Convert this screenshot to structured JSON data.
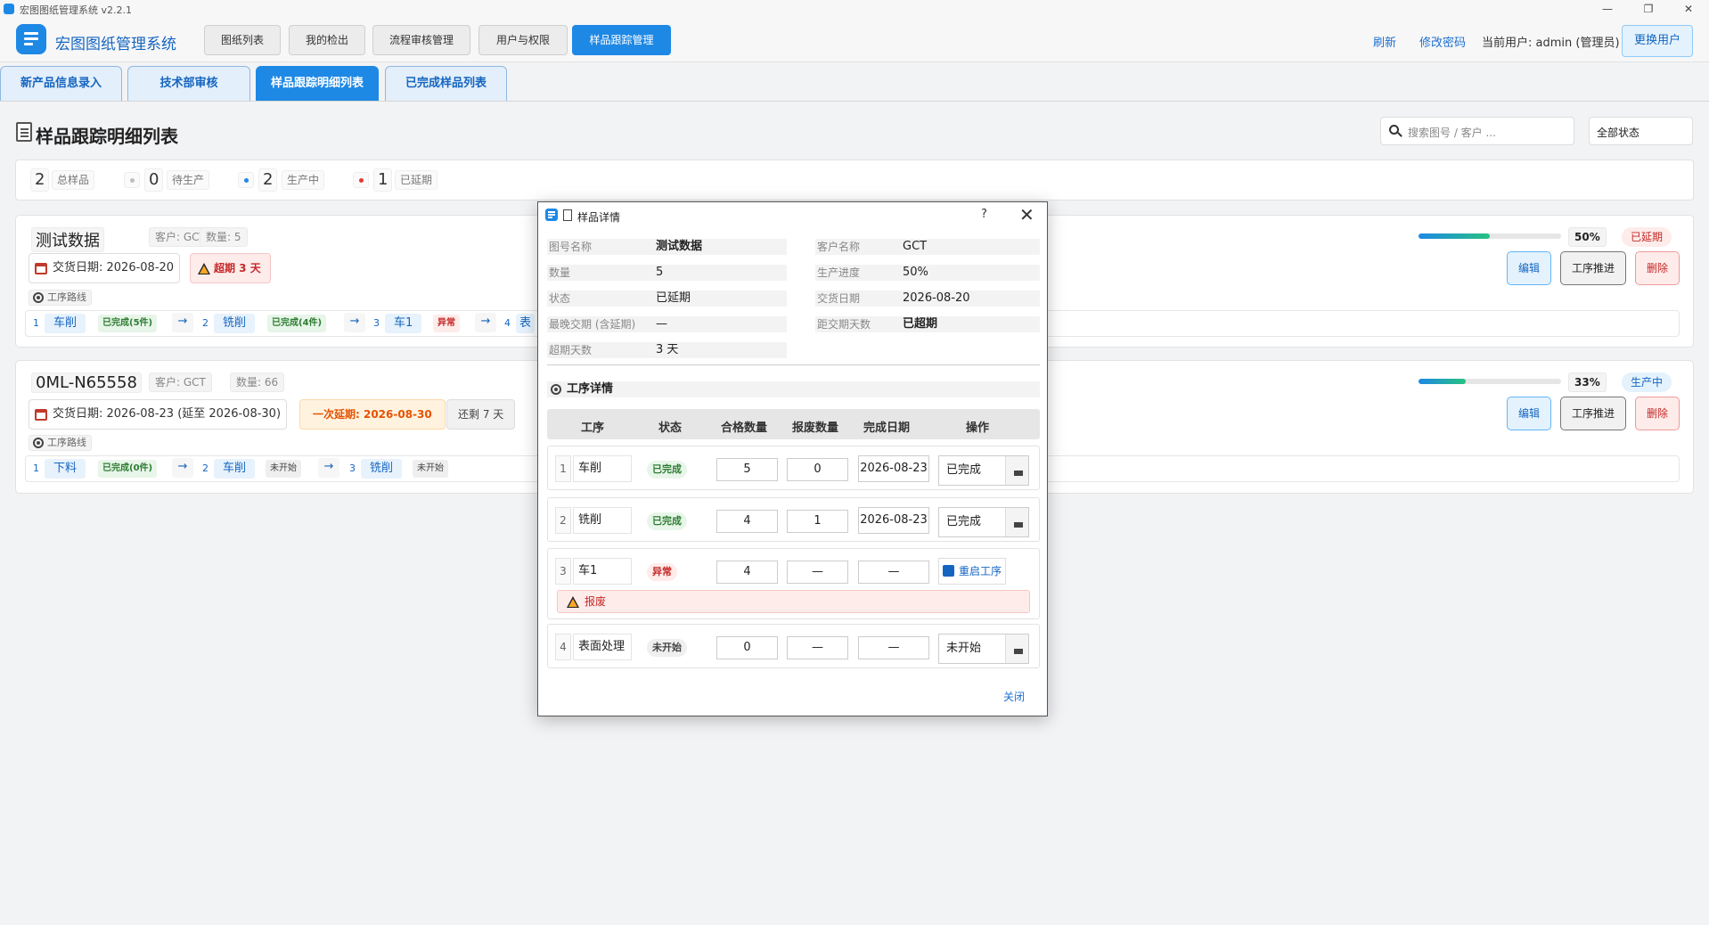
{
  "window": {
    "title": "宏图图纸管理系统  v2.2.1",
    "minimize": "—",
    "restore": "❐",
    "close": "✕"
  },
  "header": {
    "app_title": "宏图图纸管理系统",
    "nav": [
      "图纸列表",
      "我的检出",
      "流程审核管理",
      "用户与权限",
      "样品跟踪管理"
    ],
    "active_nav": 4,
    "refresh": "刷新",
    "change_password": "修改密码",
    "current_user": "当前用户: admin (管理员)",
    "switch_user": "更换用户"
  },
  "subtabs": [
    "新产品信息录入",
    "技术部审核",
    "样品跟踪明细列表",
    "已完成样品列表"
  ],
  "page": {
    "title": "样品跟踪明细列表",
    "search_placeholder": "搜索图号 / 客户 ...",
    "status_filter": "全部状态"
  },
  "stats": [
    {
      "num": "2",
      "label": "总样品"
    },
    {
      "num": "0",
      "label": "待生产",
      "dot": "#bdbdbd"
    },
    {
      "num": "2",
      "label": "生产中",
      "dot": "#1e88e5"
    },
    {
      "num": "1",
      "label": "已延期",
      "dot": "#e53935"
    }
  ],
  "cards": [
    {
      "name": "测试数据",
      "customer": "客户: GCT",
      "quantity": "数量: 5",
      "delivery": "交货日期: 2026-08-20",
      "overdue": "超期 3 天",
      "route_label": "工序路线",
      "route": [
        {
          "n": "1",
          "name": "车削",
          "status": "已完成(5件)"
        },
        {
          "n": "2",
          "name": "铣削",
          "status": "已完成(4件)"
        },
        {
          "n": "3",
          "name": "车1",
          "status": "异常"
        },
        {
          "n": "4",
          "name": "表"
        }
      ],
      "progress": 0.5,
      "progress_text": "50%",
      "badge": "已延期",
      "buttons": {
        "edit": "编辑",
        "push": "工序推进",
        "delete": "删除"
      }
    },
    {
      "name": "0ML-N65558",
      "customer": "客户: GCT",
      "quantity": "数量: 66",
      "delivery": "交货日期: 2026-08-23 (延至 2026-08-30)",
      "delay": "一次延期: 2026-08-30",
      "remaining": "还剩 7 天",
      "route_label": "工序路线",
      "route": [
        {
          "n": "1",
          "name": "下料",
          "status": "已完成(0件)"
        },
        {
          "n": "2",
          "name": "车削",
          "status": "未开始"
        },
        {
          "n": "3",
          "name": "铣削",
          "status": "未开始"
        }
      ],
      "progress": 0.33,
      "progress_text": "33%",
      "badge": "生产中",
      "buttons": {
        "edit": "编辑",
        "push": "工序推进",
        "delete": "删除"
      }
    }
  ],
  "modal": {
    "title": "样品详情",
    "help": "?",
    "close_x": "✕",
    "fields": [
      {
        "label": "图号名称",
        "value": "测试数据"
      },
      {
        "label": "客户名称",
        "value": "GCT"
      },
      {
        "label": "数量",
        "value": "5"
      },
      {
        "label": "生产进度",
        "value": "50%"
      },
      {
        "label": "状态",
        "value": "已延期"
      },
      {
        "label": "交货日期",
        "value": "2026-08-20"
      },
      {
        "label": "最晚交期 (含延期)",
        "value": "—"
      },
      {
        "label": "距交期天数",
        "value": "已超期"
      },
      {
        "label": "超期天数",
        "value": "3 天"
      }
    ],
    "section": "工序详情",
    "columns": [
      "工序",
      "状态",
      "合格数量",
      "报废数量",
      "完成日期",
      "操作"
    ],
    "processes": [
      {
        "idx": "1",
        "name": "车削",
        "status": "已完成",
        "good": "5",
        "scrap": "0",
        "date": "2026-08-23",
        "op": "已完成"
      },
      {
        "idx": "2",
        "name": "铣削",
        "status": "已完成",
        "good": "4",
        "scrap": "1",
        "date": "2026-08-23",
        "op": "已完成"
      },
      {
        "idx": "3",
        "name": "车1",
        "status": "异常",
        "good": "4",
        "scrap": "—",
        "date": "—",
        "op": "重启工序",
        "note": "报废"
      },
      {
        "idx": "4",
        "name": "表面处理",
        "status": "未开始",
        "good": "0",
        "scrap": "—",
        "date": "—",
        "op": "未开始"
      }
    ],
    "close": "关闭"
  }
}
